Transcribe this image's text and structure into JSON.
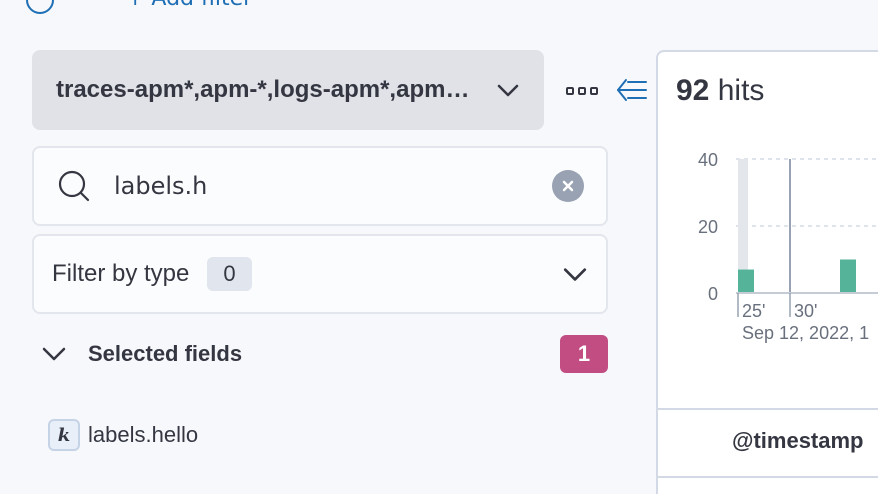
{
  "header": {
    "add_filter": "+ Add filter"
  },
  "sidebar": {
    "index_pattern": "traces-apm*,apm-*,logs-apm*,apm-*,metrics-apm*,apm-*",
    "search": {
      "value": "labels.h"
    },
    "filter_by_type": {
      "label": "Filter by type",
      "count": "0"
    },
    "selected_fields": {
      "title": "Selected fields",
      "count": "1",
      "items": [
        {
          "type": "k",
          "name": "labels.hello"
        }
      ]
    }
  },
  "main": {
    "hits_count": "92",
    "hits_label": "hits",
    "table": {
      "first_column": "@timestamp"
    }
  },
  "chart_data": {
    "type": "bar",
    "y_ticks": [
      "40",
      "20",
      "0"
    ],
    "ylim": [
      0,
      40
    ],
    "x_tick_labels": [
      "25'",
      "30'"
    ],
    "x_date_label": "Sep 12, 2022, 1",
    "bars": [
      {
        "x": "25'",
        "value": 7,
        "background_value": 40
      },
      {
        "x": "after 30'",
        "value": 10
      }
    ],
    "colors": {
      "bar": "#6dccb1",
      "bar_dark": "#54b399",
      "background_bar": "#e3e6ea"
    }
  },
  "colors": {
    "accent": "#1f6fb5",
    "badge_pink": "#c24d82"
  }
}
